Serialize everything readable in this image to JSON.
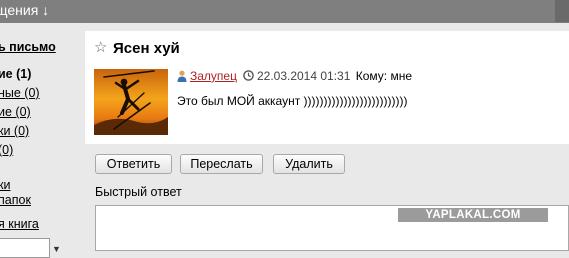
{
  "header": {
    "title": "щения ↓"
  },
  "sidebar": {
    "compose": "ь письмо",
    "items": [
      "ие (1)",
      "ные (0)",
      "ие (0)",
      "ки (0)",
      "(0)"
    ],
    "links": [
      "ки",
      "папок",
      "я книга"
    ],
    "dropdown_icon": "chevron-down-icon"
  },
  "message": {
    "subject": "Ясен хуй",
    "star_icon": "star-outline-icon",
    "author": "Залупец",
    "date": "22.03.2014 01:31",
    "to_label": "Кому:",
    "to_value": "мне",
    "body": "Это был МОЙ аккаунт ))))))))))))))))))))))))))"
  },
  "actions": {
    "reply": "Ответить",
    "forward": "Переслать",
    "delete": "Удалить"
  },
  "quick_reply": {
    "label": "Быстрый ответ"
  },
  "watermark": "YAPLAKAL.COM",
  "colors": {
    "author": "#b22222",
    "topbar": "#7f7f7f",
    "background": "#e9e9e9"
  }
}
